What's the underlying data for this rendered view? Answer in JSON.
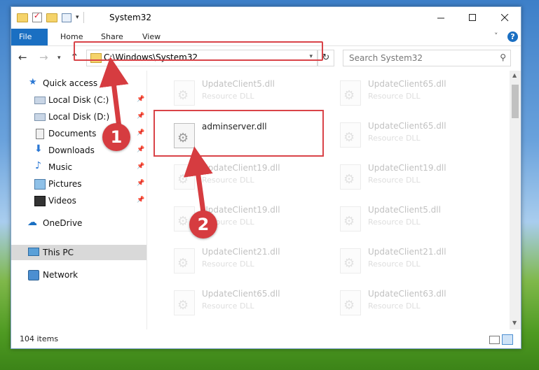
{
  "window": {
    "title": "System32"
  },
  "ribbon": {
    "tabs": [
      "File",
      "Home",
      "Share",
      "View"
    ],
    "help_icon": "?"
  },
  "address_bar": {
    "path": "C:\\Windows\\System32",
    "search_placeholder": "Search System32"
  },
  "nav_pane": {
    "items": [
      {
        "label": "Quick access",
        "icon": "star-icon",
        "pinned": false
      },
      {
        "label": "Local Disk (C:)",
        "icon": "disk-icon",
        "pinned": true
      },
      {
        "label": "Local Disk (D:)",
        "icon": "disk-icon",
        "pinned": true
      },
      {
        "label": "Documents",
        "icon": "document-icon",
        "pinned": true
      },
      {
        "label": "Downloads",
        "icon": "download-icon",
        "pinned": true
      },
      {
        "label": "Music",
        "icon": "music-icon",
        "pinned": true
      },
      {
        "label": "Pictures",
        "icon": "pictures-icon",
        "pinned": true
      },
      {
        "label": "Videos",
        "icon": "videos-icon",
        "pinned": true
      },
      {
        "label": "OneDrive",
        "icon": "cloud-icon",
        "pinned": false
      },
      {
        "label": "This PC",
        "icon": "pc-icon",
        "pinned": false,
        "selected": true
      },
      {
        "label": "Network",
        "icon": "network-icon",
        "pinned": false
      }
    ]
  },
  "files": {
    "highlighted": {
      "name": "adminserver.dll",
      "type": ""
    },
    "left_column": [
      {
        "name": "UpdateClient5.dll",
        "type": "Resource DLL"
      },
      {
        "name": "UpdateClient19.dll",
        "type": "Resource DLL"
      },
      {
        "name": "UpdateClient19.dll",
        "type": "Resource DLL"
      },
      {
        "name": "UpdateClient21.dll",
        "type": "Resource DLL"
      },
      {
        "name": "UpdateClient65.dll",
        "type": "Resource DLL"
      }
    ],
    "right_column": [
      {
        "name": "UpdateClient65.dll",
        "type": "Resource DLL"
      },
      {
        "name": "UpdateClient65.dll",
        "type": "Resource DLL"
      },
      {
        "name": "UpdateClient19.dll",
        "type": "Resource DLL"
      },
      {
        "name": "UpdateClient5.dll",
        "type": "Resource DLL"
      },
      {
        "name": "UpdateClient21.dll",
        "type": "Resource DLL"
      },
      {
        "name": "UpdateClient63.dll",
        "type": "Resource DLL"
      }
    ]
  },
  "status_bar": {
    "item_count": "104 items"
  },
  "annotations": {
    "step1": "1",
    "step2": "2",
    "color": "#d63c40"
  }
}
